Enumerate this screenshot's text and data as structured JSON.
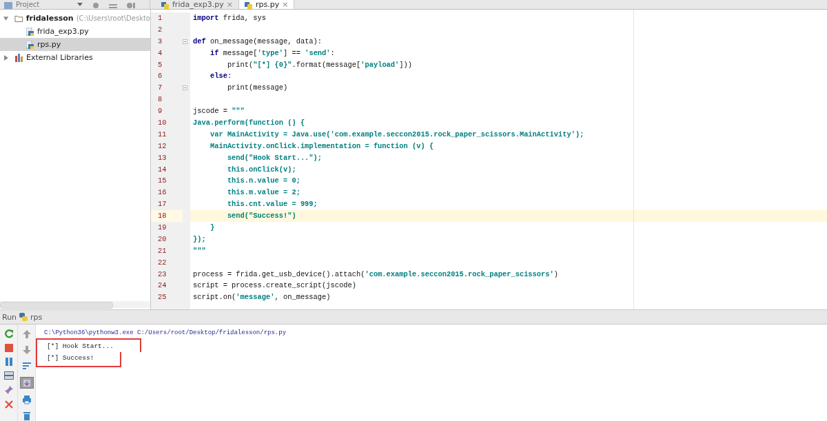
{
  "project_header": {
    "label": "Project"
  },
  "editor_tabs": [
    {
      "label": "frida_exp3.py",
      "close": "×",
      "selected": false
    },
    {
      "label": "rps.py",
      "close": "×",
      "selected": true
    }
  ],
  "project_tree": [
    {
      "name": "fridalesson",
      "path": "(C:\\Users\\root\\Deskto",
      "kind": "folder",
      "expanded": true,
      "selected": false,
      "children": [
        {
          "name": "frida_exp3.py",
          "kind": "file",
          "selected": false
        },
        {
          "name": "rps.py",
          "kind": "file",
          "selected": true
        }
      ]
    },
    {
      "name": "External Libraries",
      "kind": "library",
      "expanded": false,
      "selected": false
    }
  ],
  "code_lines": [
    {
      "number": "1",
      "current": false,
      "fold": false,
      "tokens": [
        {
          "kind": "keyword",
          "text": "import"
        },
        {
          "kind": "plain",
          "text": " frida, sys"
        }
      ]
    },
    {
      "number": "2",
      "current": false,
      "fold": false
    },
    {
      "number": "3",
      "current": false,
      "fold": true,
      "tokens": [
        {
          "kind": "keyword",
          "text": "def"
        },
        {
          "kind": "plain",
          "text": " on_message(message, data):"
        }
      ]
    },
    {
      "number": "4",
      "current": false,
      "fold": false,
      "tokens": [
        {
          "kind": "keyword",
          "text": "    if"
        },
        {
          "kind": "plain",
          "text": " message["
        },
        {
          "kind": "string",
          "text": "'type'"
        },
        {
          "kind": "plain",
          "text": "] == "
        },
        {
          "kind": "string",
          "text": "'send'"
        },
        {
          "kind": "plain",
          "text": ":"
        }
      ]
    },
    {
      "number": "5",
      "current": false,
      "fold": false,
      "tokens": [
        {
          "kind": "plain",
          "text": "        print("
        },
        {
          "kind": "string",
          "text": "\"[*] {0}\""
        },
        {
          "kind": "plain",
          "text": ".format(message["
        },
        {
          "kind": "string",
          "text": "'payload'"
        },
        {
          "kind": "plain",
          "text": "]))"
        }
      ]
    },
    {
      "number": "6",
      "current": false,
      "fold": false,
      "tokens": [
        {
          "kind": "keyword",
          "text": "    else"
        },
        {
          "kind": "plain",
          "text": ":"
        }
      ]
    },
    {
      "number": "7",
      "current": false,
      "fold": true,
      "tokens": [
        {
          "kind": "plain",
          "text": "        print(message)"
        }
      ]
    },
    {
      "number": "8",
      "current": false,
      "fold": false
    },
    {
      "number": "9",
      "current": false,
      "fold": false,
      "tokens": [
        {
          "kind": "plain",
          "text": "jscode = "
        },
        {
          "kind": "string",
          "text": "\"\"\""
        }
      ]
    },
    {
      "number": "10",
      "current": false,
      "fold": false,
      "tokens": [
        {
          "kind": "string",
          "text": "Java.perform(function () {"
        }
      ]
    },
    {
      "number": "11",
      "current": false,
      "fold": false,
      "tokens": [
        {
          "kind": "string",
          "text": "    var MainActivity = Java.use('com.example.seccon2015.rock_paper_scissors.MainActivity');"
        }
      ]
    },
    {
      "number": "12",
      "current": false,
      "fold": false,
      "tokens": [
        {
          "kind": "string",
          "text": "    MainActivity.onClick.implementation = function (v) {"
        }
      ]
    },
    {
      "number": "13",
      "current": false,
      "fold": false,
      "tokens": [
        {
          "kind": "string",
          "text": "        send(\"Hook Start...\");"
        }
      ]
    },
    {
      "number": "14",
      "current": false,
      "fold": false,
      "tokens": [
        {
          "kind": "string",
          "text": "        this.onClick(v);"
        }
      ]
    },
    {
      "number": "15",
      "current": false,
      "fold": false,
      "tokens": [
        {
          "kind": "string",
          "text": "        this.n.value = 0;"
        }
      ]
    },
    {
      "number": "16",
      "current": false,
      "fold": false,
      "tokens": [
        {
          "kind": "string",
          "text": "        this.m.value = 2;"
        }
      ]
    },
    {
      "number": "17",
      "current": false,
      "fold": false,
      "tokens": [
        {
          "kind": "string",
          "text": "        this.cnt.value = 999;"
        }
      ]
    },
    {
      "number": "18",
      "current": true,
      "fold": false,
      "tokens": [
        {
          "kind": "string",
          "text": "        send(\"Success!\")"
        }
      ]
    },
    {
      "number": "19",
      "current": false,
      "fold": false,
      "tokens": [
        {
          "kind": "string",
          "text": "    }"
        }
      ]
    },
    {
      "number": "20",
      "current": false,
      "fold": false,
      "tokens": [
        {
          "kind": "string",
          "text": "});"
        }
      ]
    },
    {
      "number": "21",
      "current": false,
      "fold": false,
      "tokens": [
        {
          "kind": "string",
          "text": "\"\"\""
        }
      ]
    },
    {
      "number": "22",
      "current": false,
      "fold": false
    },
    {
      "number": "23",
      "current": false,
      "fold": false,
      "tokens": [
        {
          "kind": "plain",
          "text": "process = frida.get_usb_device().attach("
        },
        {
          "kind": "string",
          "text": "'com.example.seccon2015.rock_paper_scissors'"
        },
        {
          "kind": "plain",
          "text": ")"
        }
      ]
    },
    {
      "number": "24",
      "current": false,
      "fold": false,
      "tokens": [
        {
          "kind": "plain",
          "text": "script = process.create_script(jscode)"
        }
      ]
    },
    {
      "number": "25",
      "current": false,
      "fold": false,
      "tokens": [
        {
          "kind": "plain",
          "text": "script.on("
        },
        {
          "kind": "string",
          "text": "'message'"
        },
        {
          "kind": "plain",
          "text": ", on_message)"
        }
      ]
    }
  ],
  "run_panel": {
    "label": "Run",
    "config": "rps",
    "console_tools": [
      {
        "on": false
      },
      {
        "on": false
      },
      {
        "on": false
      },
      {
        "on": true
      },
      {
        "on": false
      },
      {
        "on": false
      }
    ],
    "command": "C:\\Python36\\pythonw3.exe C:/Users/root/Desktop/fridalesson/rps.py",
    "output": [
      {
        "text": "[*] Hook Start...",
        "highlighted": true
      },
      {
        "text": "[*] Success!",
        "highlighted": true
      }
    ]
  }
}
